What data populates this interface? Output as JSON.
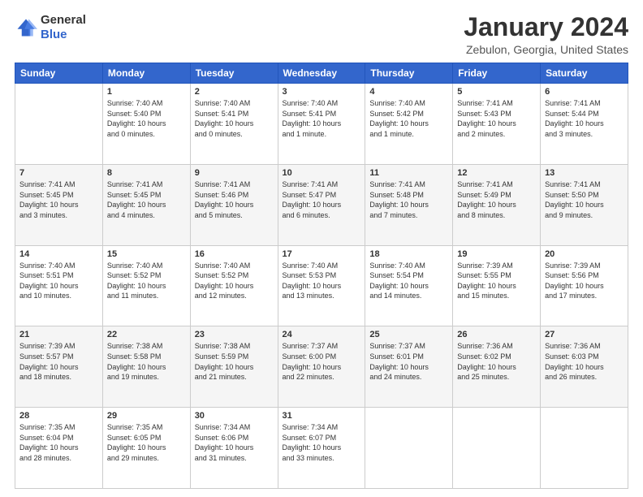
{
  "logo": {
    "general": "General",
    "blue": "Blue"
  },
  "header": {
    "title": "January 2024",
    "location": "Zebulon, Georgia, United States"
  },
  "days_of_week": [
    "Sunday",
    "Monday",
    "Tuesday",
    "Wednesday",
    "Thursday",
    "Friday",
    "Saturday"
  ],
  "weeks": [
    [
      {
        "day": "",
        "info": ""
      },
      {
        "day": "1",
        "info": "Sunrise: 7:40 AM\nSunset: 5:40 PM\nDaylight: 10 hours\nand 0 minutes."
      },
      {
        "day": "2",
        "info": "Sunrise: 7:40 AM\nSunset: 5:41 PM\nDaylight: 10 hours\nand 0 minutes."
      },
      {
        "day": "3",
        "info": "Sunrise: 7:40 AM\nSunset: 5:41 PM\nDaylight: 10 hours\nand 1 minute."
      },
      {
        "day": "4",
        "info": "Sunrise: 7:40 AM\nSunset: 5:42 PM\nDaylight: 10 hours\nand 1 minute."
      },
      {
        "day": "5",
        "info": "Sunrise: 7:41 AM\nSunset: 5:43 PM\nDaylight: 10 hours\nand 2 minutes."
      },
      {
        "day": "6",
        "info": "Sunrise: 7:41 AM\nSunset: 5:44 PM\nDaylight: 10 hours\nand 3 minutes."
      }
    ],
    [
      {
        "day": "7",
        "info": "Sunrise: 7:41 AM\nSunset: 5:45 PM\nDaylight: 10 hours\nand 3 minutes."
      },
      {
        "day": "8",
        "info": "Sunrise: 7:41 AM\nSunset: 5:45 PM\nDaylight: 10 hours\nand 4 minutes."
      },
      {
        "day": "9",
        "info": "Sunrise: 7:41 AM\nSunset: 5:46 PM\nDaylight: 10 hours\nand 5 minutes."
      },
      {
        "day": "10",
        "info": "Sunrise: 7:41 AM\nSunset: 5:47 PM\nDaylight: 10 hours\nand 6 minutes."
      },
      {
        "day": "11",
        "info": "Sunrise: 7:41 AM\nSunset: 5:48 PM\nDaylight: 10 hours\nand 7 minutes."
      },
      {
        "day": "12",
        "info": "Sunrise: 7:41 AM\nSunset: 5:49 PM\nDaylight: 10 hours\nand 8 minutes."
      },
      {
        "day": "13",
        "info": "Sunrise: 7:41 AM\nSunset: 5:50 PM\nDaylight: 10 hours\nand 9 minutes."
      }
    ],
    [
      {
        "day": "14",
        "info": "Sunrise: 7:40 AM\nSunset: 5:51 PM\nDaylight: 10 hours\nand 10 minutes."
      },
      {
        "day": "15",
        "info": "Sunrise: 7:40 AM\nSunset: 5:52 PM\nDaylight: 10 hours\nand 11 minutes."
      },
      {
        "day": "16",
        "info": "Sunrise: 7:40 AM\nSunset: 5:52 PM\nDaylight: 10 hours\nand 12 minutes."
      },
      {
        "day": "17",
        "info": "Sunrise: 7:40 AM\nSunset: 5:53 PM\nDaylight: 10 hours\nand 13 minutes."
      },
      {
        "day": "18",
        "info": "Sunrise: 7:40 AM\nSunset: 5:54 PM\nDaylight: 10 hours\nand 14 minutes."
      },
      {
        "day": "19",
        "info": "Sunrise: 7:39 AM\nSunset: 5:55 PM\nDaylight: 10 hours\nand 15 minutes."
      },
      {
        "day": "20",
        "info": "Sunrise: 7:39 AM\nSunset: 5:56 PM\nDaylight: 10 hours\nand 17 minutes."
      }
    ],
    [
      {
        "day": "21",
        "info": "Sunrise: 7:39 AM\nSunset: 5:57 PM\nDaylight: 10 hours\nand 18 minutes."
      },
      {
        "day": "22",
        "info": "Sunrise: 7:38 AM\nSunset: 5:58 PM\nDaylight: 10 hours\nand 19 minutes."
      },
      {
        "day": "23",
        "info": "Sunrise: 7:38 AM\nSunset: 5:59 PM\nDaylight: 10 hours\nand 21 minutes."
      },
      {
        "day": "24",
        "info": "Sunrise: 7:37 AM\nSunset: 6:00 PM\nDaylight: 10 hours\nand 22 minutes."
      },
      {
        "day": "25",
        "info": "Sunrise: 7:37 AM\nSunset: 6:01 PM\nDaylight: 10 hours\nand 24 minutes."
      },
      {
        "day": "26",
        "info": "Sunrise: 7:36 AM\nSunset: 6:02 PM\nDaylight: 10 hours\nand 25 minutes."
      },
      {
        "day": "27",
        "info": "Sunrise: 7:36 AM\nSunset: 6:03 PM\nDaylight: 10 hours\nand 26 minutes."
      }
    ],
    [
      {
        "day": "28",
        "info": "Sunrise: 7:35 AM\nSunset: 6:04 PM\nDaylight: 10 hours\nand 28 minutes."
      },
      {
        "day": "29",
        "info": "Sunrise: 7:35 AM\nSunset: 6:05 PM\nDaylight: 10 hours\nand 29 minutes."
      },
      {
        "day": "30",
        "info": "Sunrise: 7:34 AM\nSunset: 6:06 PM\nDaylight: 10 hours\nand 31 minutes."
      },
      {
        "day": "31",
        "info": "Sunrise: 7:34 AM\nSunset: 6:07 PM\nDaylight: 10 hours\nand 33 minutes."
      },
      {
        "day": "",
        "info": ""
      },
      {
        "day": "",
        "info": ""
      },
      {
        "day": "",
        "info": ""
      }
    ]
  ]
}
